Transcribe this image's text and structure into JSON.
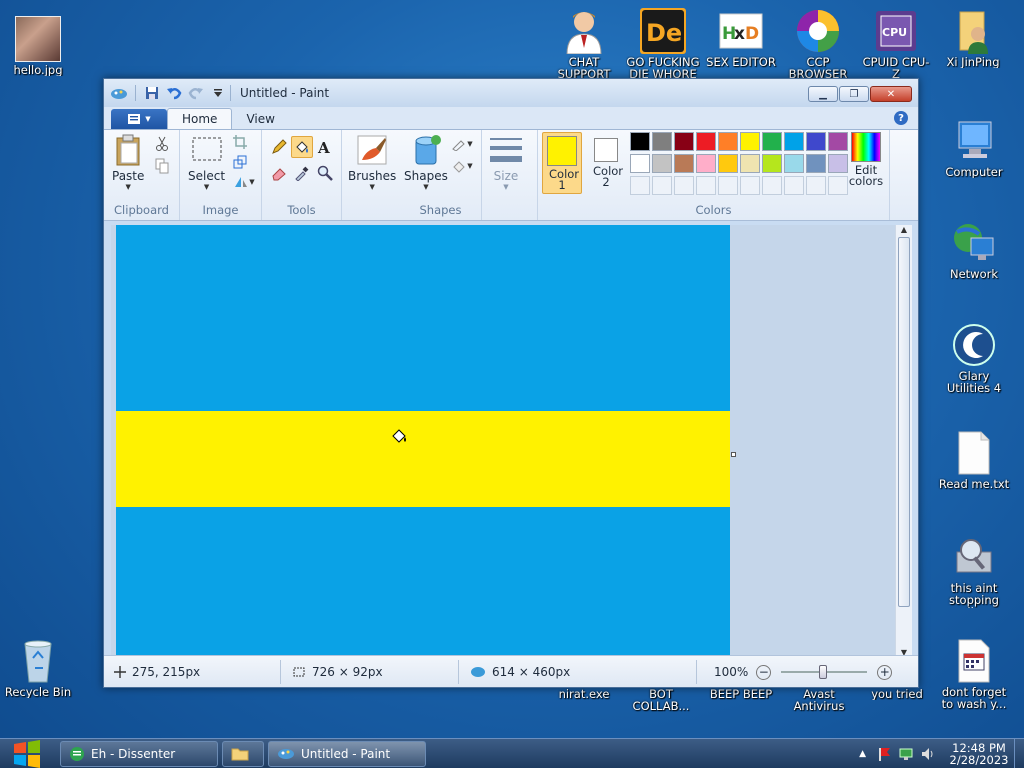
{
  "desktop": {
    "icons": [
      {
        "id": "hello",
        "label": "hello.jpg"
      },
      {
        "id": "chat",
        "label": "CHAT SUPPORT"
      },
      {
        "id": "gofd",
        "label": "GO FUCKING DIE WHORE"
      },
      {
        "id": "sexed",
        "label": "SEX EDITOR"
      },
      {
        "id": "ccp",
        "label": "CCP BROWSER"
      },
      {
        "id": "cpuid",
        "label": "CPUID CPU-Z"
      },
      {
        "id": "xijp",
        "label": "Xi JinPing"
      },
      {
        "id": "computer",
        "label": "Computer"
      },
      {
        "id": "network",
        "label": "Network"
      },
      {
        "id": "glary",
        "label": "Glary Utilities 4"
      },
      {
        "id": "readme",
        "label": "Read me.txt"
      },
      {
        "id": "aint",
        "label": "this aint stopping di..."
      },
      {
        "id": "recycle",
        "label": "Recycle Bin"
      },
      {
        "id": "nirat",
        "label": "nirat.exe"
      },
      {
        "id": "bot",
        "label": "BOT COLLAB..."
      },
      {
        "id": "beep",
        "label": "BEEP BEEP"
      },
      {
        "id": "avast",
        "label": "Avast Antivirus"
      },
      {
        "id": "youtried",
        "label": "you tried"
      },
      {
        "id": "dontforget",
        "label": "dont forget to wash y..."
      }
    ]
  },
  "window": {
    "title": "Untitled - Paint",
    "tabs": [
      "Home",
      "View"
    ],
    "ribbon": {
      "clipboard": {
        "label": "Clipboard",
        "paste": "Paste"
      },
      "image": {
        "label": "Image",
        "select": "Select"
      },
      "tools": {
        "label": "Tools"
      },
      "brushes": "Brushes",
      "shapes": {
        "label": "Shapes",
        "shapes": "Shapes"
      },
      "size": "Size",
      "color1": "Color 1",
      "color2": "Color 2",
      "colors_label": "Colors",
      "edit_colors": "Edit colors"
    },
    "palette_row1": [
      "#000000",
      "#7f7f7f",
      "#880015",
      "#ed1c24",
      "#ff7f27",
      "#fff200",
      "#22b14c",
      "#00a2e8",
      "#3f48cc",
      "#a349a4"
    ],
    "palette_row2": [
      "#ffffff",
      "#c3c3c3",
      "#b97a57",
      "#ffaec9",
      "#ffc90e",
      "#efe4b0",
      "#b5e61d",
      "#99d9ea",
      "#7092be",
      "#c8bfe7"
    ],
    "color1_value": "#fff200",
    "color2_value": "#ffffff",
    "canvas": {
      "top_color": "#0aa2e6",
      "band_color": "#fff200"
    },
    "status": {
      "cursor": "275, 215px",
      "selection": "726 × 92px",
      "size": "614 × 460px",
      "zoom": "100%"
    }
  },
  "taskbar": {
    "items": [
      "Eh - Dissenter",
      "Untitled - Paint"
    ],
    "time": "12:48 PM",
    "date": "2/28/2023"
  }
}
